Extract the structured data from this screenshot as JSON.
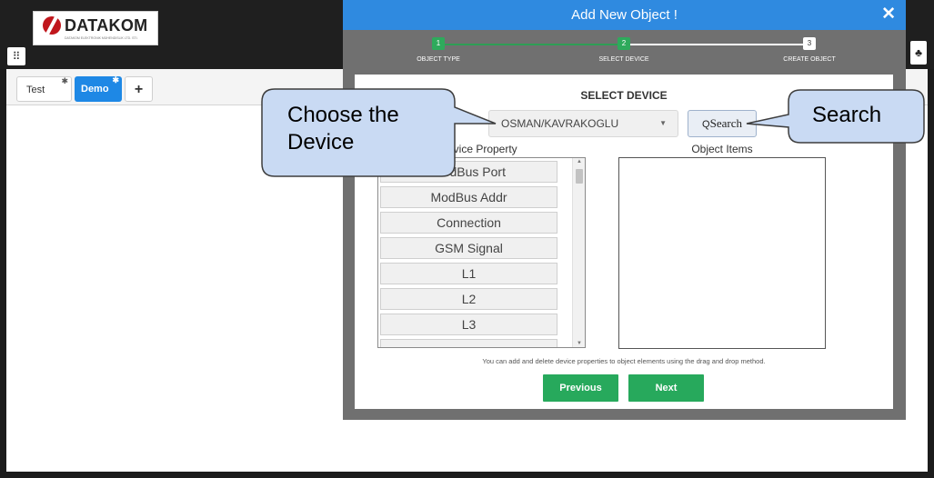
{
  "app": {
    "logo_text": "DATAKOM",
    "logo_subtitle": "DATAKOM ELEKTRONIK MÜHENDISLIK LTD. STI.",
    "apps_icon": "grid-icon",
    "right_icon": "tree-icon"
  },
  "tabs": [
    {
      "label": "Test",
      "active": false
    },
    {
      "label": "Demo",
      "active": true
    }
  ],
  "tab_add_label": "+",
  "modal": {
    "title": "Add New Object !",
    "close_label": "✕",
    "steps": [
      {
        "number": "1",
        "label": "OBJECT TYPE",
        "state": "done"
      },
      {
        "number": "2",
        "label": "SELECT DEVICE",
        "state": "done"
      },
      {
        "number": "3",
        "label": "CREATE OBJECT",
        "state": "todo"
      }
    ],
    "section_title": "SELECT DEVICE",
    "device_select": {
      "value": "OSMAN/KAVRAKOGLU",
      "caret": "▼"
    },
    "search_button": {
      "icon": "search-icon",
      "label": "Search"
    },
    "property_heading": "Device Property",
    "items_heading": "Object Items",
    "properties": [
      "ModBus Port",
      "ModBus Addr",
      "Connection",
      "GSM Signal",
      "L1",
      "L2",
      "L3",
      ""
    ],
    "hint": "You can add and delete device properties to object elements using the drag and drop method.",
    "previous_label": "Previous",
    "next_label": "Next"
  },
  "callouts": {
    "device": "Choose the\nDevice",
    "search": "Search"
  },
  "colors": {
    "header_blue": "#2f8ae0",
    "step_green": "#2eaa5c",
    "button_green": "#27a95c",
    "tab_active_blue": "#1e88e5",
    "callout_fill": "#c9daf3"
  }
}
